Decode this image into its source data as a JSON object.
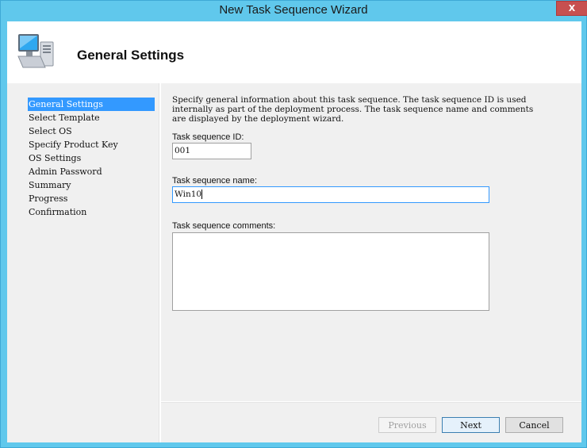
{
  "window": {
    "title": "New Task Sequence Wizard",
    "close_glyph": "X",
    "close_icon": "close-icon"
  },
  "header": {
    "title": "General Settings",
    "icon": "computer-icon"
  },
  "sidebar": {
    "items": [
      {
        "label": "General Settings",
        "selected": true
      },
      {
        "label": "Select Template"
      },
      {
        "label": "Select OS"
      },
      {
        "label": "Specify Product Key"
      },
      {
        "label": "OS Settings"
      },
      {
        "label": "Admin Password"
      },
      {
        "label": "Summary"
      },
      {
        "label": "Progress"
      },
      {
        "label": "Confirmation"
      }
    ]
  },
  "main": {
    "description": [
      "Specify general information about this task sequence.  The task sequence ID is used",
      "internally as part of the deployment process.  The task sequence name and comments",
      "are displayed by the deployment wizard."
    ],
    "task_sequence_id": {
      "label": "Task sequence ID:",
      "value": "001"
    },
    "task_sequence_name": {
      "label": "Task sequence name:",
      "value": "Win10"
    },
    "task_sequence_comments": {
      "label": "Task sequence comments:",
      "value": ""
    }
  },
  "footer": {
    "previous_label": "Previous",
    "next_label": "Next",
    "cancel_label": "Cancel"
  },
  "colors": {
    "titlebar": "#60c8ec",
    "selection": "#3399ff",
    "close_button": "#c75050",
    "panel": "#f0f0f0"
  }
}
